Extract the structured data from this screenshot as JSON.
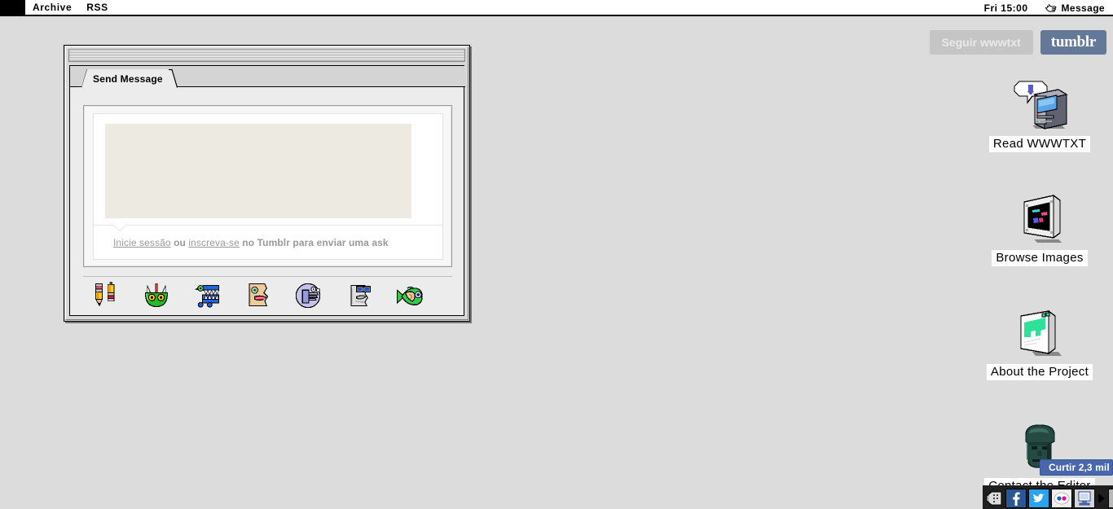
{
  "desktop": {
    "background_color": "#dcdcdc"
  },
  "menubar": {
    "apple_icon": "apple-logo-icon",
    "items": [
      {
        "label": "Archive",
        "name": "menu-archive"
      },
      {
        "label": "RSS",
        "name": "menu-rss"
      }
    ],
    "clock": "Fri 15:00",
    "message_menu": {
      "icon": "pointing-hand-icon",
      "label": "Message"
    }
  },
  "window": {
    "titlebar_style": "striped-platinum",
    "tab": {
      "label": "Send Message"
    },
    "ask_form": {
      "textarea_value": "",
      "textarea_placeholder": "",
      "login_prompt": {
        "link_login": "Inicie sessão",
        "middle": " ou ",
        "link_signup": "inscreva-se",
        "tail": " no Tumblr para enviar uma ask"
      }
    },
    "shelf_icons": [
      {
        "name": "pencils-icon",
        "title": "Pencils"
      },
      {
        "name": "green-creature-face-icon",
        "title": "Green Creature"
      },
      {
        "name": "blue-jaw-machine-icon",
        "title": "Blue Jaw Machine"
      },
      {
        "name": "lips-face-icon",
        "title": "Face with Lips"
      },
      {
        "name": "purple-hand-icon",
        "title": "Pointing Hand"
      },
      {
        "name": "binoculars-face-icon",
        "title": "Face with Binoculars"
      },
      {
        "name": "fish-ear-icon",
        "title": "Fish with Ear"
      }
    ]
  },
  "tumblr_controls": {
    "follow_label": "Seguir wwwtxt",
    "tumblr_label": "tumblr",
    "follow_bg": "#c5c5c5",
    "tumblr_bg": "#64799a"
  },
  "desktop_icons": [
    {
      "name": "desktop-icon-read-wwwtxt",
      "label": "Read WWWTXT",
      "glyph": "classic-mac-computer-icon"
    },
    {
      "name": "desktop-icon-browse-images",
      "label": "Browse Images",
      "glyph": "picture-frame-icon"
    },
    {
      "name": "desktop-icon-about-project",
      "label": "About the Project",
      "glyph": "notepad-icon"
    },
    {
      "name": "desktop-icon-contact-editor",
      "label": "Contact the Editor",
      "glyph": "stone-head-icon"
    }
  ],
  "facebook_like": {
    "icon": "thumbs-up-icon",
    "label": "Curtir 2,3 mil",
    "color": "#4867ad"
  },
  "social_dock": {
    "buttons": [
      {
        "name": "dock-rss-icon",
        "title": "RSS"
      },
      {
        "name": "dock-facebook-icon",
        "title": "Facebook"
      },
      {
        "name": "dock-twitter-icon",
        "title": "Twitter"
      },
      {
        "name": "dock-flickr-icon",
        "title": "Flickr"
      },
      {
        "name": "dock-screen-icon",
        "title": "Screen"
      },
      {
        "name": "dock-window-icon",
        "title": "Window"
      }
    ],
    "arrow": "play-arrow-icon"
  }
}
